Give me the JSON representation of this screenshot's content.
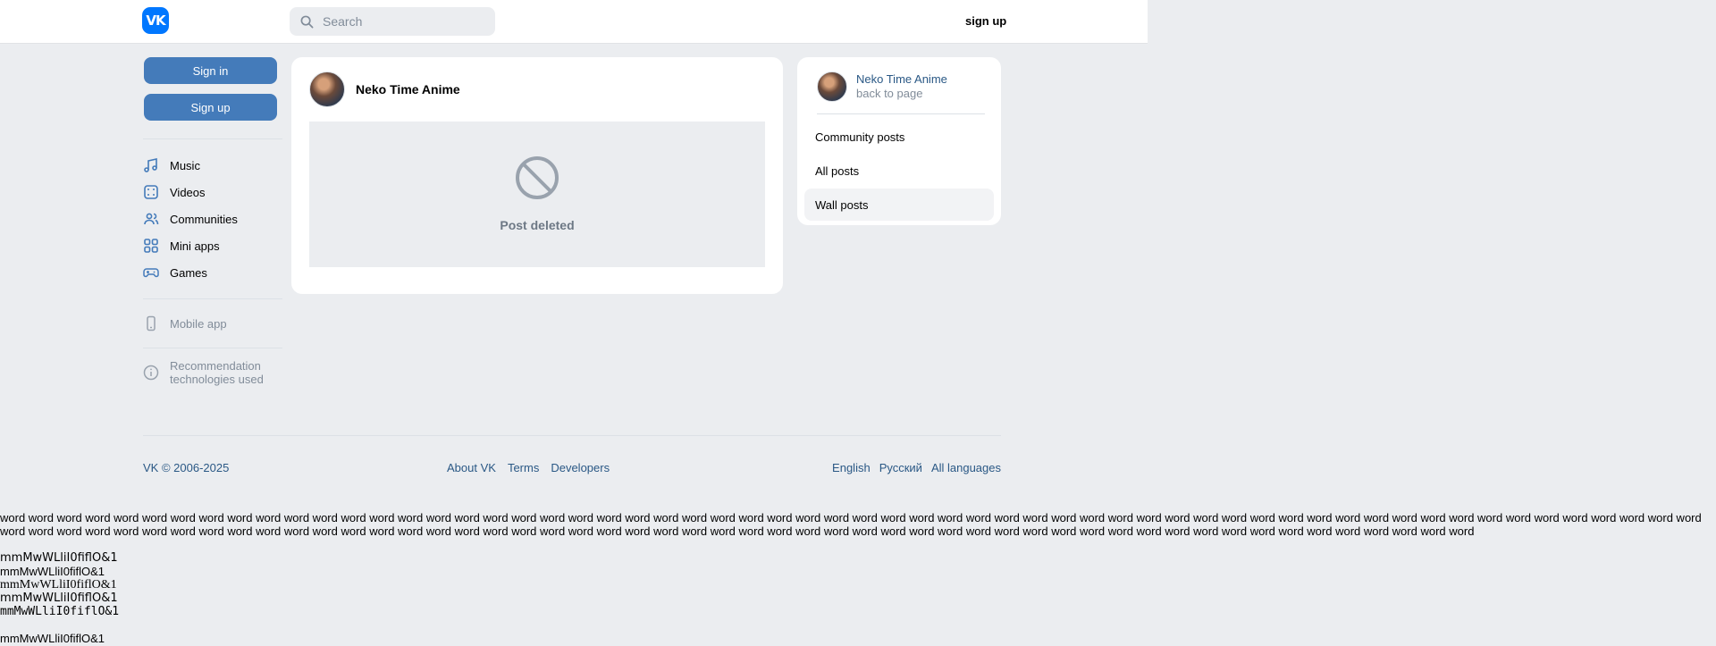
{
  "header": {
    "logo": "VK",
    "search_placeholder": "Search",
    "signup_label": "sign up"
  },
  "sidebar": {
    "signin_label": "Sign in",
    "signup_label": "Sign up",
    "items": [
      {
        "label": "Music",
        "icon": "music-icon"
      },
      {
        "label": "Videos",
        "icon": "video-icon"
      },
      {
        "label": "Communities",
        "icon": "users-icon"
      },
      {
        "label": "Mini apps",
        "icon": "grid-icon"
      },
      {
        "label": "Games",
        "icon": "gamepad-icon"
      }
    ],
    "mobile_app": "Mobile app",
    "recommendation": [
      "Recommendation",
      "technologies used"
    ]
  },
  "post": {
    "author": "Neko Time Anime",
    "deleted_label": "Post deleted"
  },
  "side_panel": {
    "name": "Neko Time Anime",
    "subtitle": "back to page",
    "menu": [
      "Community posts",
      "All posts",
      "Wall posts"
    ]
  },
  "footer": {
    "copyright": "VK © 2006-2025",
    "links": [
      "About VK",
      "Terms",
      "Developers"
    ],
    "languages": [
      "English",
      "Русский",
      "All languages"
    ]
  },
  "test_text": {
    "words": "word word word word word word word word word word word word word word word word word word word word word word word word word word word word word word word word word word word word word word word word word word word word word word word word word word word word word word word word word word word word word word word word word word word word word word word word word word word word word word word word word word word word word word word word word word word word word word word word word word word word word word word word word word word word word word word word",
    "samples": [
      "mmMwWLliI0fiflO&1",
      "mmMwWLliI0fiflO&1",
      "mmMwWLliI0fiflO&1",
      "mmMwWLliI0fiflO&1",
      "mmMwWLliI0fiflO&1",
      "mmMwWLliI0fiflO&1"
    ]
  }
}
